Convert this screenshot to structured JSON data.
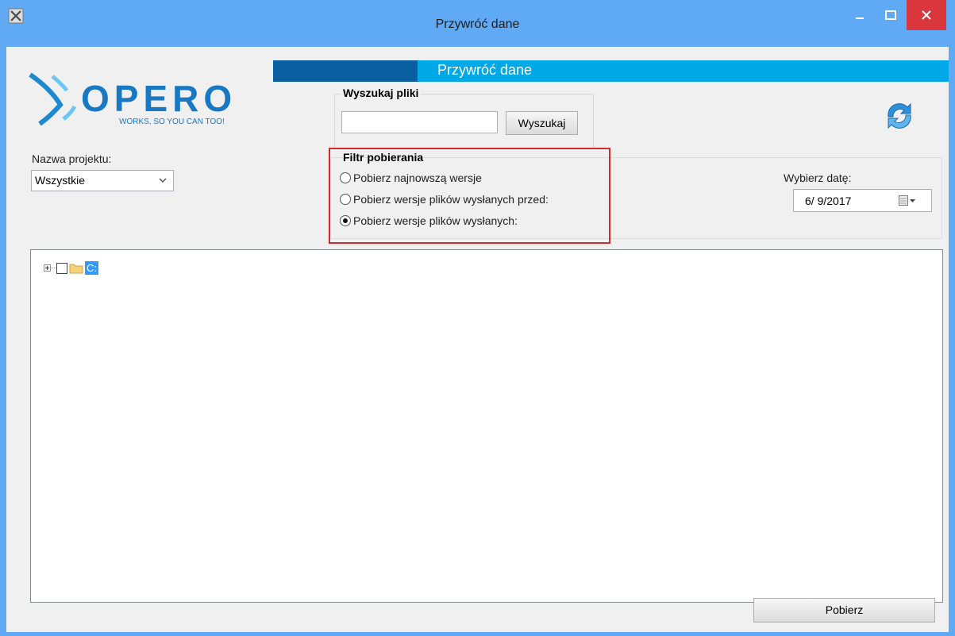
{
  "window": {
    "title": "Przywróć dane"
  },
  "header": {
    "title": "Przywróć dane",
    "colors": {
      "bar": "#00a8e8",
      "bar_dark": "#0a5fa0"
    }
  },
  "logo": {
    "text": "XOPERO",
    "tagline": "WORKS, SO YOU CAN TOO!"
  },
  "search": {
    "group_label": "Wyszukaj pliki",
    "input_value": "",
    "button_label": "Wyszukaj"
  },
  "project": {
    "label": "Nazwa projektu:",
    "selected": "Wszystkie"
  },
  "filter": {
    "group_label": "Filtr pobierania",
    "options": [
      {
        "label": "Pobierz najnowszą wersje",
        "checked": false
      },
      {
        "label": "Pobierz wersje plików wysłanych przed:",
        "checked": false
      },
      {
        "label": "Pobierz wersje plików wysłanych:",
        "checked": true
      }
    ],
    "highlight_color": "#d42a2a"
  },
  "date": {
    "label": "Wybierz datę:",
    "value": "6/  9/2017"
  },
  "tree": {
    "nodes": [
      {
        "label": "C:",
        "checked": false,
        "expanded": false,
        "selected": true
      }
    ]
  },
  "footer": {
    "download_label": "Pobierz"
  },
  "icons": [
    "app-icon",
    "minimize-icon",
    "maximize-icon",
    "close-icon",
    "refresh-icon",
    "chevron-down-icon",
    "calendar-icon",
    "folder-icon"
  ]
}
